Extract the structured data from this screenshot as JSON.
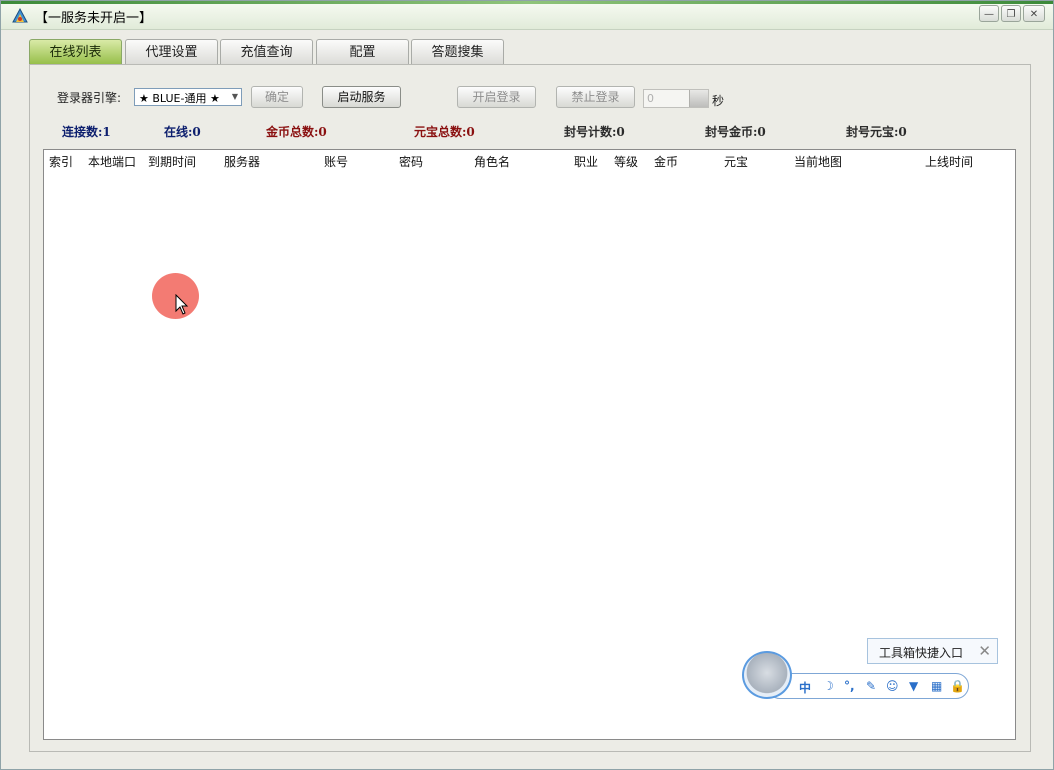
{
  "window": {
    "title": "【一服务未开启一】"
  },
  "tabs": [
    {
      "label": "在线列表",
      "active": true
    },
    {
      "label": "代理设置"
    },
    {
      "label": "充值查询"
    },
    {
      "label": "配置"
    },
    {
      "label": "答题搜集"
    }
  ],
  "controls": {
    "engine_label": "登录器引擎:",
    "engine_value": "★ BLUE-通用 ★",
    "confirm_label": "确定",
    "start_service_label": "启动服务",
    "open_login_label": "开启登录",
    "ban_login_label": "禁止登录",
    "seconds_value": "0",
    "seconds_unit": "秒"
  },
  "stats": {
    "connections": "连接数:1",
    "online": "在线:0",
    "gold_total": "金币总数:0",
    "yuanbao_total": "元宝总数:0",
    "ban_count": "封号计数:0",
    "ban_gold": "封号金币:0",
    "ban_yuanbao": "封号元宝:0"
  },
  "columns": [
    "索引",
    "本地端口",
    "到期时间",
    "服务器",
    "账号",
    "密码",
    "角色名",
    "职业",
    "等级",
    "金币",
    "元宝",
    "当前地图",
    "上线时间"
  ],
  "toolbox": {
    "tooltip": "工具箱快捷入口",
    "close_glyph": "✕",
    "icons": [
      "中",
      "☽",
      "°,",
      "✎",
      "☺",
      "▼",
      "▦",
      "🔒"
    ]
  }
}
